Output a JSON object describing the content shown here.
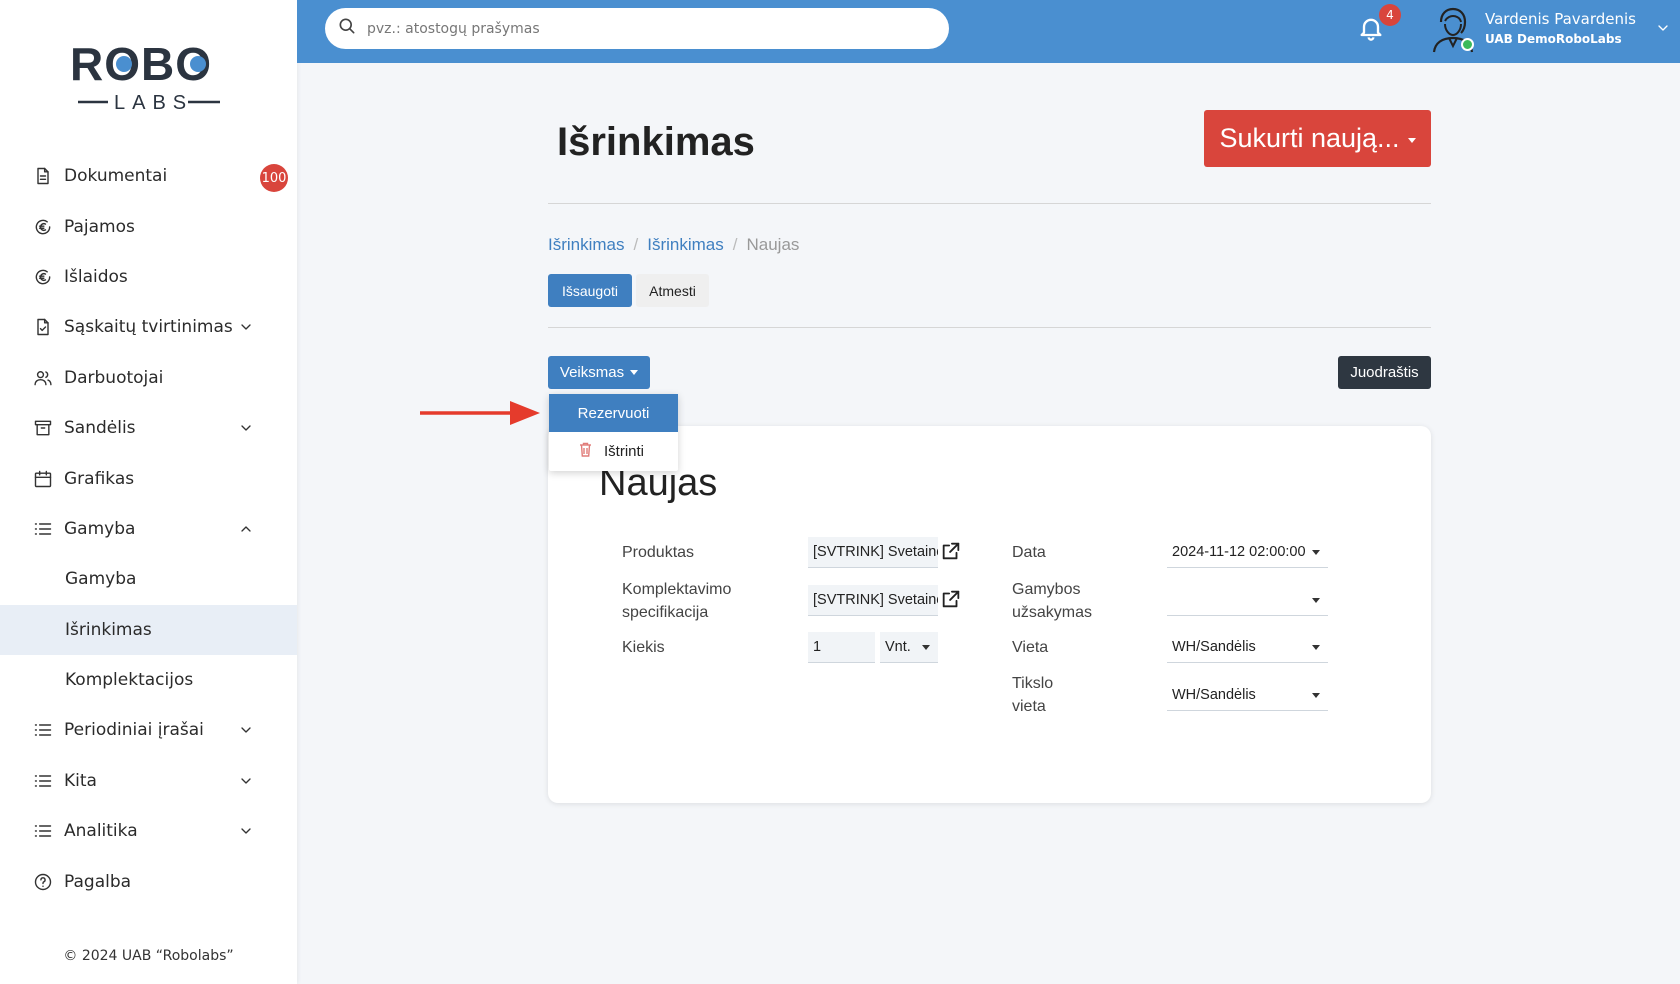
{
  "brand": {
    "logo_top": "ROBO",
    "logo_bottom": "LABS"
  },
  "sidebar": {
    "items": [
      {
        "label": "Dokumentai",
        "icon": "document-icon",
        "badge": "100"
      },
      {
        "label": "Pajamos",
        "icon": "euro-icon"
      },
      {
        "label": "Išlaidos",
        "icon": "euro-icon"
      },
      {
        "label": "Sąskaitų tvirtinimas",
        "icon": "document-check-icon",
        "expandable": true
      },
      {
        "label": "Darbuotojai",
        "icon": "users-icon"
      },
      {
        "label": "Sandėlis",
        "icon": "archive-icon",
        "expandable": true
      },
      {
        "label": "Grafikas",
        "icon": "calendar-icon"
      },
      {
        "label": "Gamyba",
        "icon": "list-icon",
        "expanded": true
      },
      {
        "label": "Gamyba",
        "sub": true
      },
      {
        "label": "Išrinkimas",
        "sub": true,
        "active": true
      },
      {
        "label": "Komplektacijos",
        "sub": true
      },
      {
        "label": "Periodiniai įrašai",
        "icon": "list-icon",
        "expandable": true
      },
      {
        "label": "Kita",
        "icon": "list-icon",
        "expandable": true
      },
      {
        "label": "Analitika",
        "icon": "list-icon",
        "expandable": true
      },
      {
        "label": "Pagalba",
        "icon": "help-icon"
      }
    ],
    "copyright": "© 2024 UAB “Robolabs”"
  },
  "topbar": {
    "search_placeholder": "pvz.: atostogų prašymas",
    "notifications": "4",
    "user_name": "Vardenis Pavardenis",
    "company": "UAB DemoRoboLabs"
  },
  "main": {
    "title": "Išrinkimas",
    "create_label": "Sukurti naują...",
    "breadcrumb": [
      "Išrinkimas",
      "Išrinkimas",
      "Naujas"
    ],
    "save_label": "Išsaugoti",
    "discard_label": "Atmesti",
    "action_label": "Veiksmas",
    "status_label": "Juodraštis",
    "dropdown": {
      "reserve": "Rezervuoti",
      "delete": "Ištrinti"
    },
    "card_title": "Naujas",
    "fields": {
      "product_label": "Produktas",
      "product_value": "[SVTRINK] Svetainė",
      "spec_label_1": "Komplektavimo",
      "spec_label_2": "specifikacija",
      "spec_value": "[SVTRINK] Svetainė",
      "qty_label": "Kiekis",
      "qty_value": "1",
      "uom_value": "Vnt.",
      "date_label": "Data",
      "date_value": "2024-11-12 02:00:00",
      "order_label_1": "Gamybos",
      "order_label_2": "užsakymas",
      "order_value": "",
      "location_label": "Vieta",
      "location_value": "WH/Sandėlis",
      "dest_label_1": "Tikslo",
      "dest_label_2": "vieta",
      "dest_value": "WH/Sandėlis"
    }
  },
  "colors": {
    "accent": "#4a8fd0",
    "primary_button": "#3f7fc0",
    "danger": "#d9453c",
    "dark_button": "#2e3741"
  }
}
